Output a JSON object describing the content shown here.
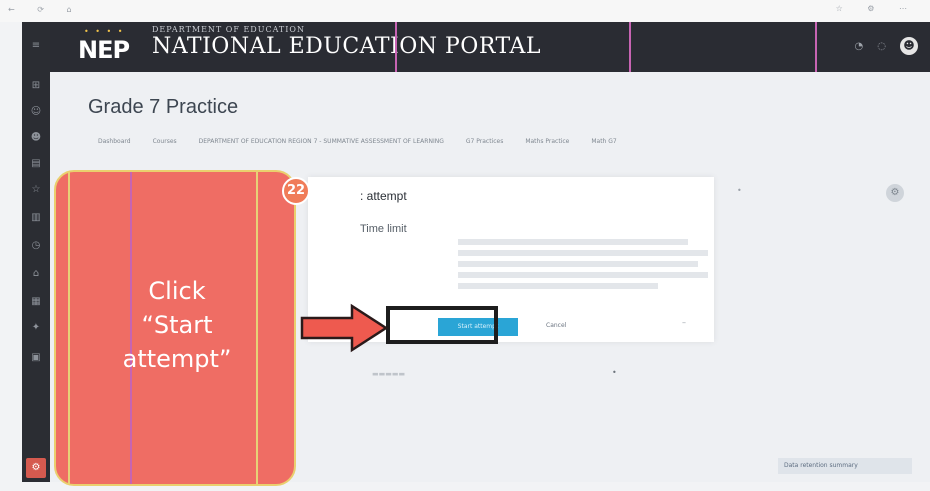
{
  "browser": {
    "nav_glyphs": "← ⟳ ⌂",
    "url": "",
    "right_glyphs": "☆ ⚙ ⋯"
  },
  "brand": {
    "logo": "NEP",
    "department_line": "DEPARTMENT OF EDUCATION",
    "portal_name": "NATIONAL EDUCATION PORTAL"
  },
  "page": {
    "title": "Grade 7 Practice",
    "breadcrumbs": [
      "Dashboard",
      "Courses",
      "DEPARTMENT OF EDUCATION REGION 7 - SUMMATIVE ASSESSMENT OF LEARNING",
      "G7 Practices",
      "Maths Practice",
      "Math G7"
    ]
  },
  "modal": {
    "title": ": attempt",
    "time_label": "Time limit",
    "start_button": "Start attempt",
    "cancel": "Cancel"
  },
  "step": {
    "number": "22"
  },
  "callout": {
    "text": "Click\n“Start\nattempt”"
  },
  "footer": {
    "link": "Data retention summary"
  },
  "colors": {
    "topbar": "#2a2c33",
    "callout": "#ef6d64",
    "start_button": "#2aa5d6",
    "step_badge": "#f07c59"
  }
}
